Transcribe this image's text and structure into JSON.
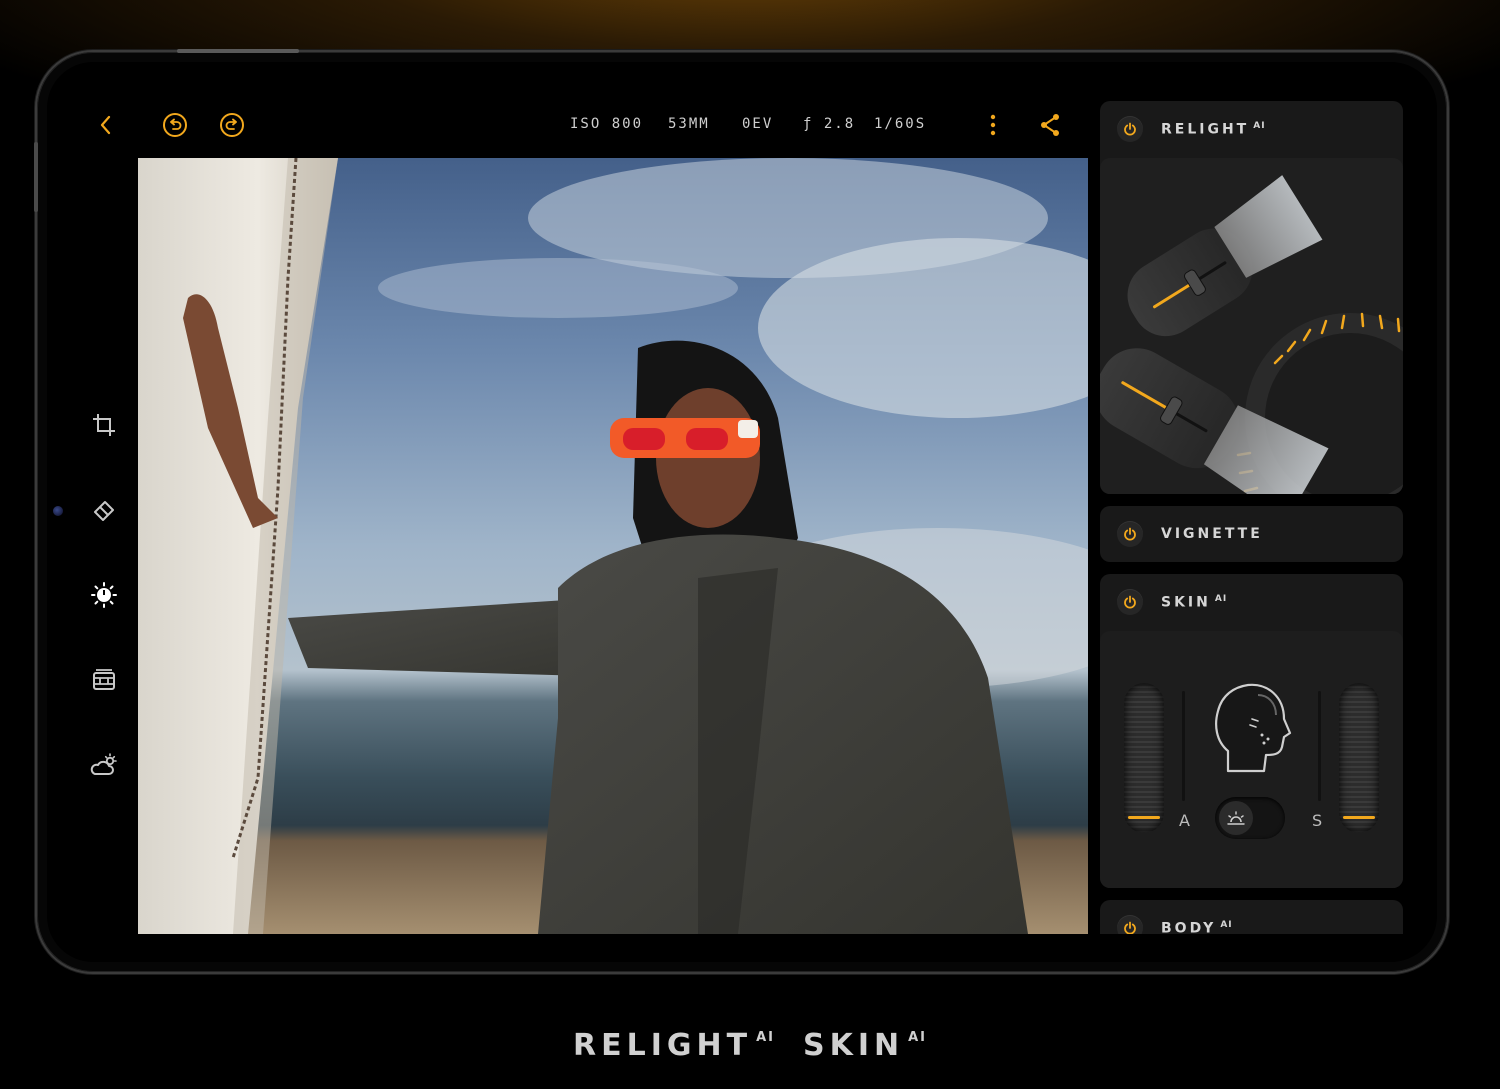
{
  "topbar": {
    "back_icon": "chevron-left-icon",
    "undo_icon": "undo-icon",
    "redo_icon": "redo-icon",
    "exif": {
      "iso": "ISO 800",
      "focal": "53MM",
      "ev": "0EV",
      "aperture": "ƒ 2.8",
      "shutter": "1/60S"
    },
    "more_icon": "more-vertical-icon",
    "share_icon": "share-icon"
  },
  "tools": [
    {
      "icon": "crop-icon"
    },
    {
      "icon": "eraser-icon"
    },
    {
      "icon": "exposure-icon",
      "active": true
    },
    {
      "icon": "film-icon"
    },
    {
      "icon": "weather-icon"
    }
  ],
  "panels": {
    "relight": {
      "title": "RELIGHT",
      "ai": "AI"
    },
    "vignette": {
      "title": "VIGNETTE"
    },
    "skin": {
      "title": "SKIN",
      "ai": "AI",
      "left_label": "A",
      "right_label": "S",
      "toggle_icon": "sun-face-icon"
    },
    "body": {
      "title": "BODY",
      "ai": "AI"
    }
  },
  "caption": {
    "relight": "RELIGHT",
    "relight_ai": "AI",
    "skin": "SKIN",
    "skin_ai": "AI"
  },
  "colors": {
    "accent": "#f2a81d",
    "panel": "#191919",
    "background": "#000000"
  }
}
